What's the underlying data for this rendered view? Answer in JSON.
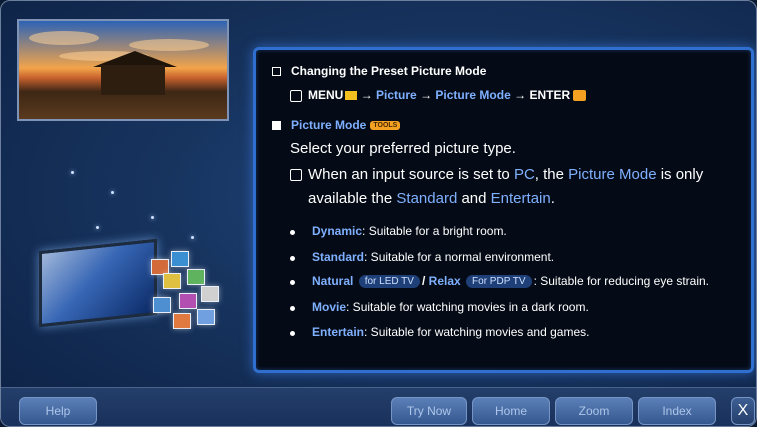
{
  "content": {
    "heading": "Changing the Preset Picture Mode",
    "path": {
      "menu": "MENU",
      "arrow1": "→",
      "picture": "Picture",
      "arrow2": "→",
      "picture_mode": "Picture Mode",
      "arrow3": "→",
      "enter": "ENTER"
    },
    "section_title": "Picture Mode",
    "tools_badge": "TOOLS",
    "description": "Select your preferred picture type.",
    "note": {
      "part1": "When an input source is set to",
      "pc": "PC",
      "part2": ", the",
      "picture_mode": "Picture Mode",
      "part3": "is only",
      "line2_part1": "available the",
      "standard": "Standard",
      "and": "and",
      "entertain": "Entertain",
      "end": "."
    },
    "bullets": [
      {
        "term": "Dynamic",
        "text": ": Suitable for a bright room."
      },
      {
        "term": "Standard",
        "text": ": Suitable for a normal environment."
      },
      {
        "term": "Natural",
        "pill1": "for LED TV",
        "slash": "/",
        "term2": "Relax",
        "pill2": "For PDP TV",
        "text": ": Suitable for reducing eye strain."
      },
      {
        "term": "Movie",
        "text": ": Suitable for watching movies in a dark room."
      },
      {
        "term": "Entertain",
        "text": ": Suitable for watching movies and games."
      }
    ]
  },
  "buttons": {
    "help": "Help",
    "try_now": "Try Now",
    "home": "Home",
    "zoom": "Zoom",
    "index": "Index",
    "close": "X"
  },
  "colors": {
    "accent_blue": "#7fb0ff",
    "panel_border": "#2f6fd0",
    "tools_orange": "#f4a020"
  }
}
